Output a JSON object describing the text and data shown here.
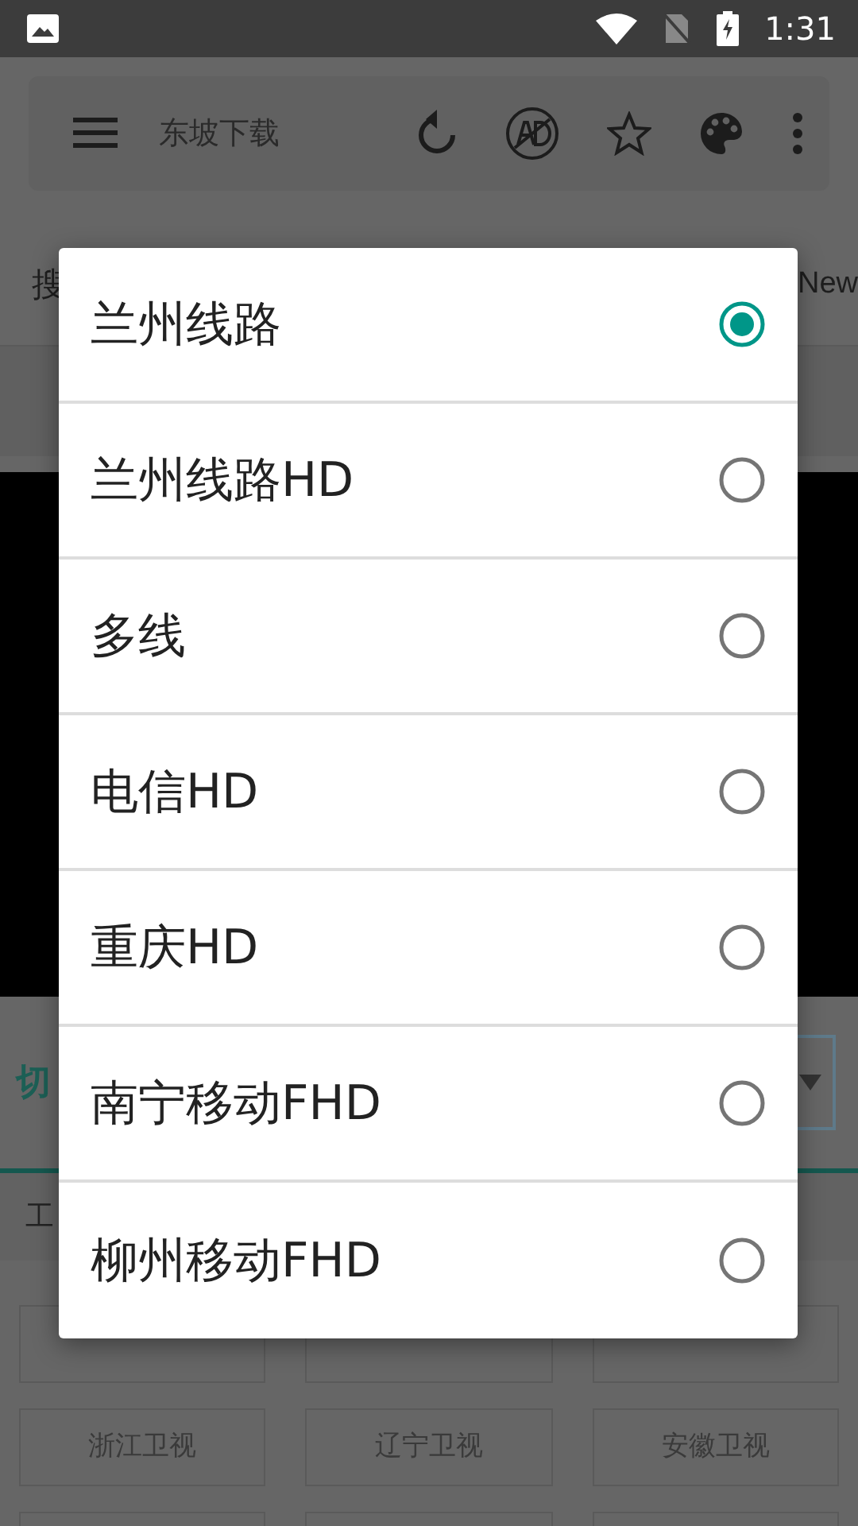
{
  "status_bar": {
    "time": "1:31"
  },
  "toolbar": {
    "title": "东坡下载"
  },
  "search_row": {
    "left": "搜",
    "right": "New"
  },
  "switch_row": {
    "label": "切"
  },
  "tabs": [
    {
      "label": "工"
    }
  ],
  "channel_grid": {
    "rows": [
      [
        "浙江卫视",
        "辽宁卫视",
        "安徽卫视"
      ]
    ]
  },
  "dialog": {
    "options": [
      {
        "label": "兰州线路",
        "selected": true
      },
      {
        "label": "兰州线路HD",
        "selected": false
      },
      {
        "label": "多线",
        "selected": false
      },
      {
        "label": "电信HD",
        "selected": false
      },
      {
        "label": "重庆HD",
        "selected": false
      },
      {
        "label": "南宁移动FHD",
        "selected": false
      },
      {
        "label": "柳州移动FHD",
        "selected": false
      }
    ]
  }
}
